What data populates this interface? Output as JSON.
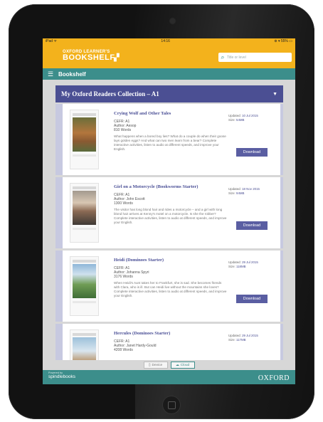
{
  "status": {
    "carrier": "iPad ᯤ",
    "time": "14:16",
    "battery": "⊛ ▾ 55% ▭"
  },
  "header": {
    "logo_line1": "OXFORD LEARNER'S",
    "logo_line2": "BOOKSHELF",
    "search_placeholder": "Title or level"
  },
  "nav": {
    "title": "Bookshelf"
  },
  "collection": {
    "title": "My Oxford Readers Collection – A1"
  },
  "books": [
    {
      "title": "Crying Wolf and Other Tales",
      "cefr": "CEFR: A1",
      "author": "Author: Aesop",
      "words": "810 Words",
      "desc": "What happens when a bored boy lies? What do a couple do when their goose lays golden eggs? And what can two men learn from a bear? Complete interactive activities, listen to audio at different speeds, and improve your English.",
      "updated": "10 Jul 2015",
      "size": "54MB",
      "button": "Download"
    },
    {
      "title": "Girl on a Motorcycle (Bookworms Starter)",
      "cefr": "CEFR: A1",
      "author": "Author: John Escott",
      "words": "1300 Words",
      "desc": "The visitor has long blond hair and rides a motorcycle – and a girl with long blond hair arrives at Kenny's motel on a motorcycle. Is she the robber? Complete interactive activities, listen to audio at different speeds, and improve your English.",
      "updated": "18 Nov 2015",
      "size": "94MB",
      "button": "Download"
    },
    {
      "title": "Heidi (Dominoes Starter)",
      "cefr": "CEFR: A1",
      "author": "Author: Johanna Spyri",
      "words": "3176 Words",
      "desc": "When Heidi's Aunt takes her to Frankfurt, she is sad. She becomes friends with Clara, who is ill. But can Heidi live without the mountains she loves? Complete interactive activities, listen to audio at different speeds, and improve your English.",
      "updated": "29 Jul 2015",
      "size": "118MB",
      "button": "Download"
    },
    {
      "title": "Hercules (Dominoes Starter)",
      "cefr": "CEFR: A1",
      "author": "Author: Janet Hardy-Gould",
      "words": "4208 Words",
      "desc": "",
      "updated": "29 Jul 2015",
      "size": "117MB",
      "button": ""
    }
  ],
  "labels": {
    "updated": "Updated:",
    "size": "Size:"
  },
  "tabs": [
    {
      "label": "Device"
    },
    {
      "label": "Cloud"
    }
  ],
  "footer": {
    "powered": "Powered by",
    "brand": "spindlebooks",
    "publisher": "OXFORD"
  },
  "colors": {
    "header": "#f3b21c",
    "teal": "#3c8e8b",
    "purple": "#4b4f93"
  }
}
